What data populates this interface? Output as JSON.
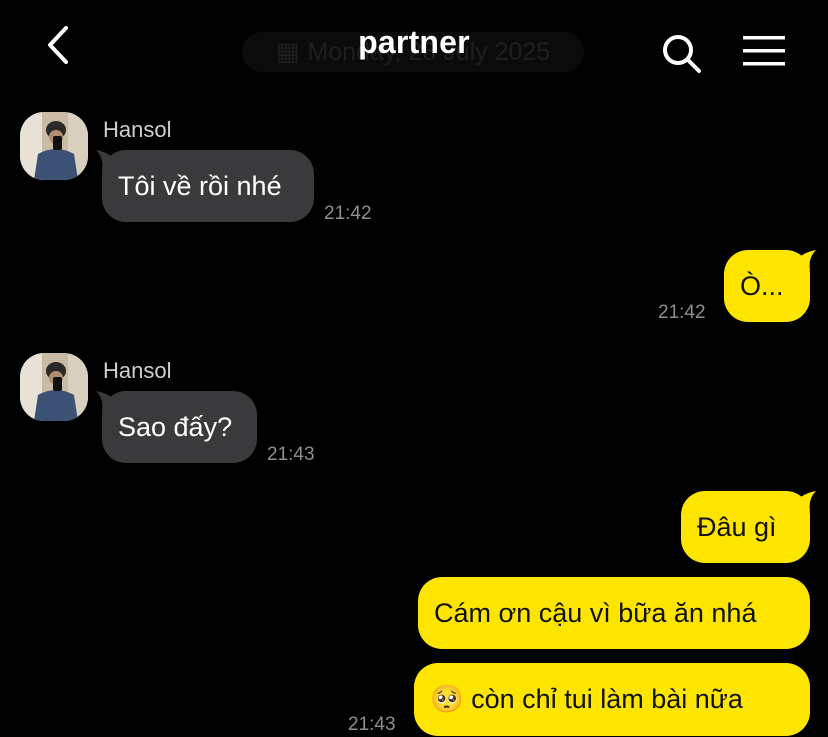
{
  "header": {
    "title": "partner",
    "date_label": "Monday, 28 July 2025",
    "icons": {
      "back": "chevron-left-icon",
      "search": "search-icon",
      "menu": "hamburger-menu-icon",
      "calendar": "calendar-icon"
    }
  },
  "messages": [
    {
      "direction": "incoming",
      "sender": "Hansol",
      "text": "Tôi về rồi nhé",
      "time": "21:42"
    },
    {
      "direction": "outgoing",
      "text": "Ò...",
      "time": "21:42"
    },
    {
      "direction": "incoming",
      "sender": "Hansol",
      "text": "Sao đấy?",
      "time": "21:43"
    },
    {
      "direction": "outgoing",
      "text": "Đâu gì"
    },
    {
      "direction": "outgoing",
      "text": "Cám ơn cậu vì bữa ăn nhá"
    },
    {
      "direction": "outgoing",
      "emoji": "🥺",
      "text": "còn chỉ tui làm bài nữa",
      "time": "21:43"
    }
  ],
  "colors": {
    "background": "#000000",
    "incoming_bubble": "#3a3a3c",
    "outgoing_bubble": "#fee500",
    "timestamp": "#8e8e8e"
  }
}
